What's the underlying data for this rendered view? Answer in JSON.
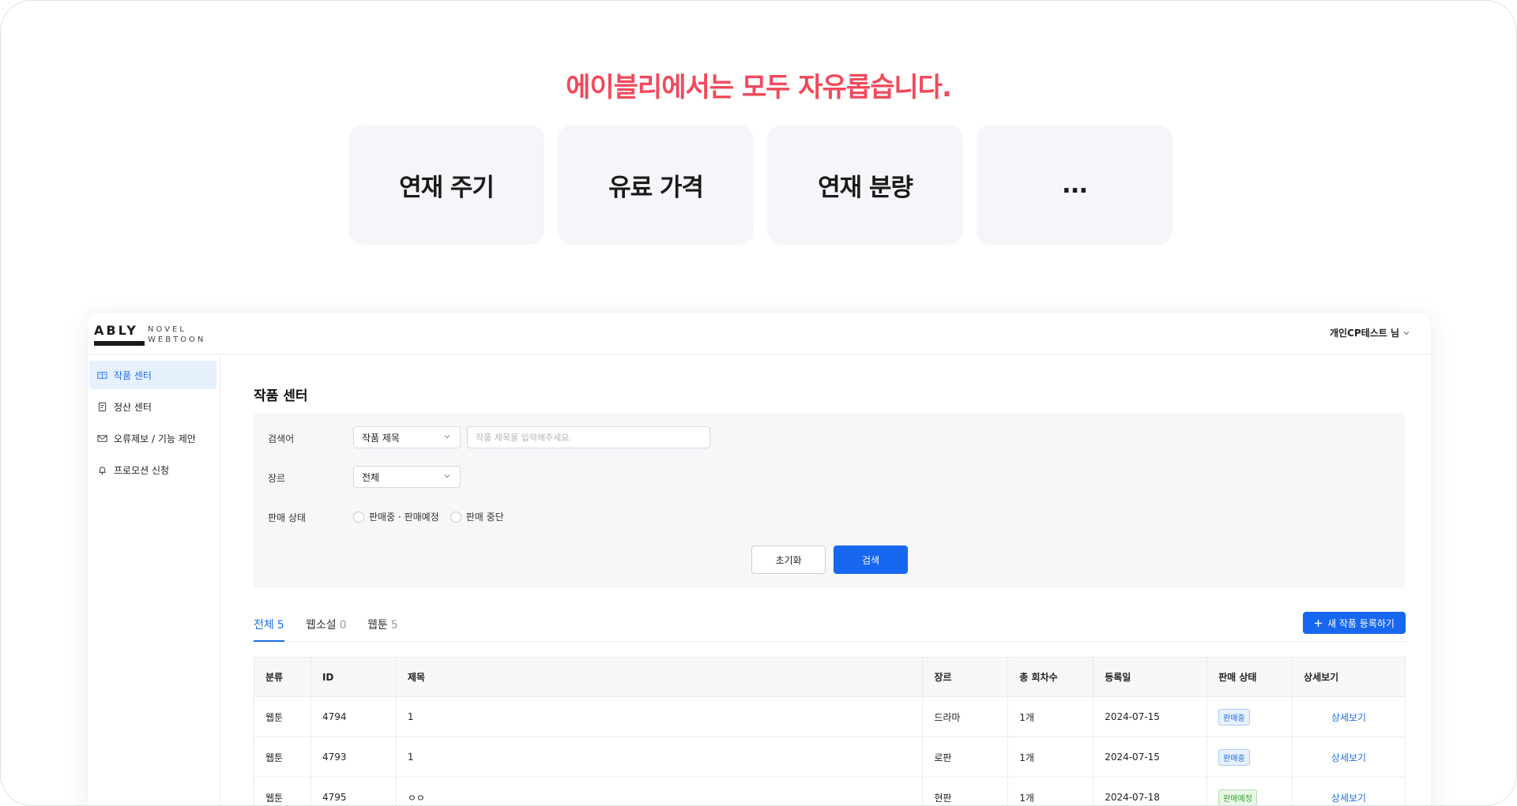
{
  "headline": "에이블리에서는 모두 자유롭습니다.",
  "cards": [
    "연재 주기",
    "유료 가격",
    "연재 분량",
    "..."
  ],
  "app": {
    "logo": {
      "brand": "ABLY",
      "line1": "NOVEL",
      "line2": "WEBTOON"
    },
    "user_label": "개인CP테스트 님",
    "sidebar": [
      {
        "label": "작품 센터",
        "icon": "book-icon"
      },
      {
        "label": "정산 센터",
        "icon": "receipt-icon"
      },
      {
        "label": "오류제보 / 기능 제안",
        "icon": "mail-icon"
      },
      {
        "label": "프로모션 신청",
        "icon": "bell-icon"
      }
    ],
    "page_title": "작품 센터",
    "filter": {
      "search_label": "검색어",
      "search_type": "작품 제목",
      "search_placeholder": "작품 제목을 입력해주세요.",
      "genre_label": "장르",
      "genre_value": "전체",
      "status_label": "판매 상태",
      "status_options": [
        "판매중 · 판매예정",
        "판매 중단"
      ],
      "reset_label": "초기화",
      "search_button": "검색"
    },
    "tabs": [
      {
        "label": "전체",
        "count": "5"
      },
      {
        "label": "웹소설",
        "count": "0"
      },
      {
        "label": "웹툰",
        "count": "5"
      }
    ],
    "new_button": "새 작품 등록하기",
    "table": {
      "headers": [
        "분류",
        "ID",
        "제목",
        "장르",
        "총 회차수",
        "등록일",
        "판매 상태",
        "상세보기"
      ],
      "rows": [
        {
          "category": "웹툰",
          "id": "4794",
          "title": "1",
          "genre": "드라마",
          "episodes": "1개",
          "date": "2024-07-15",
          "status": "판매중",
          "status_kind": "on",
          "detail": "상세보기"
        },
        {
          "category": "웹툰",
          "id": "4793",
          "title": "1",
          "genre": "로판",
          "episodes": "1개",
          "date": "2024-07-15",
          "status": "판매중",
          "status_kind": "on",
          "detail": "상세보기"
        },
        {
          "category": "웹툰",
          "id": "4795",
          "title": "ㅇㅇ",
          "genre": "현판",
          "episodes": "1개",
          "date": "2024-07-18",
          "status": "판매예정",
          "status_kind": "soon",
          "detail": "상세보기"
        }
      ]
    }
  }
}
